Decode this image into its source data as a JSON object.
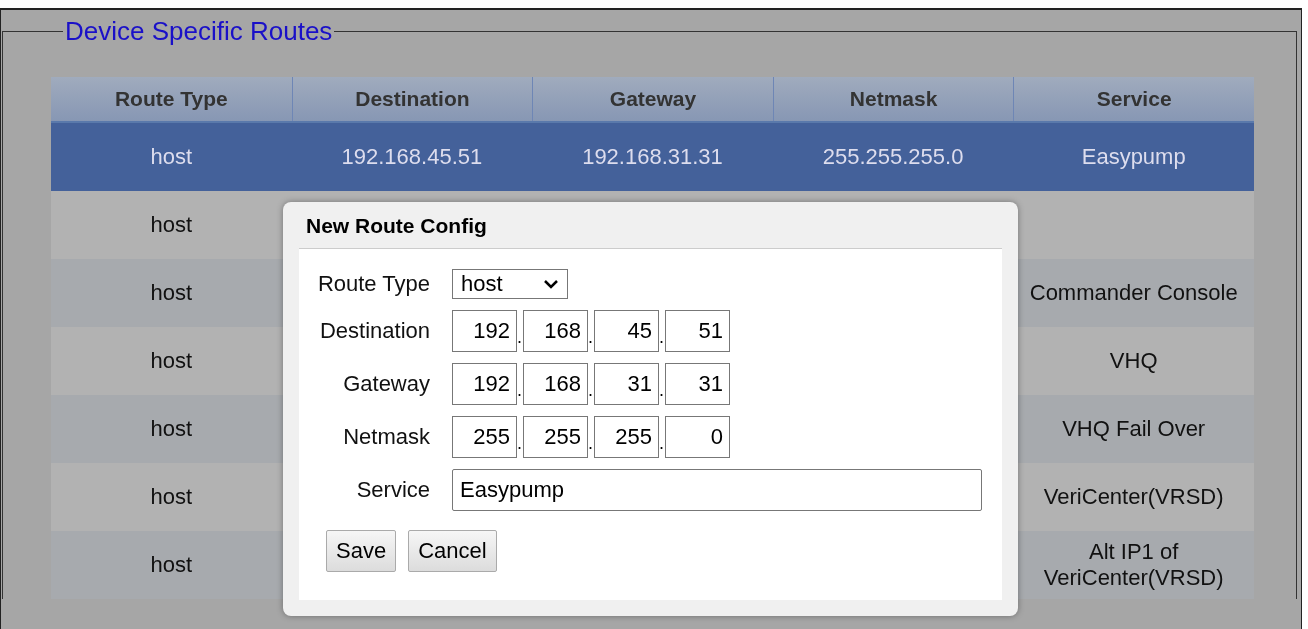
{
  "section": {
    "legend": "Device Specific Routes"
  },
  "table": {
    "columns": [
      "Route Type",
      "Destination",
      "Gateway",
      "Netmask",
      "Service"
    ],
    "rows": [
      {
        "selected": true,
        "route_type": "host",
        "destination": "192.168.45.51",
        "gateway": "192.168.31.31",
        "netmask": "255.255.255.0",
        "service": "Easypump"
      },
      {
        "selected": false,
        "route_type": "host"
      },
      {
        "selected": false,
        "route_type": "host",
        "service": "Commander Console"
      },
      {
        "selected": false,
        "route_type": "host",
        "service": "VHQ"
      },
      {
        "selected": false,
        "route_type": "host",
        "service": "VHQ Fail Over"
      },
      {
        "selected": false,
        "route_type": "host",
        "service": "VeriCenter(VRSD)"
      },
      {
        "selected": false,
        "route_type": "host",
        "service": "Alt IP1 of VeriCenter(VRSD)"
      }
    ]
  },
  "dialog": {
    "title": "New Route Config",
    "fields": [
      {
        "kind": "select",
        "label": "Route Type",
        "value": "host"
      },
      {
        "kind": "ip",
        "label": "Destination",
        "separator": ".",
        "octets": [
          "192",
          "168",
          "45",
          "51"
        ]
      },
      {
        "kind": "ip",
        "label": "Gateway",
        "separator": ".",
        "octets": [
          "192",
          "168",
          "31",
          "31"
        ]
      },
      {
        "kind": "ip",
        "label": "Netmask",
        "separator": ".",
        "octets": [
          "255",
          "255",
          "255",
          "0"
        ]
      },
      {
        "kind": "text",
        "label": "Service",
        "value": "Easypump"
      }
    ],
    "buttons": [
      "Save",
      "Cancel"
    ]
  }
}
